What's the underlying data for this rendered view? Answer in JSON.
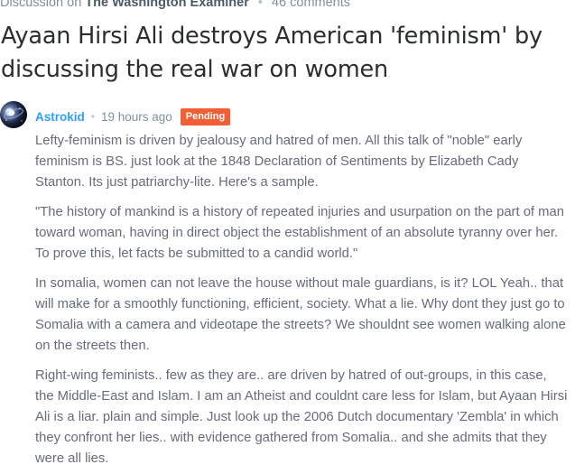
{
  "discussion": {
    "prefix": "Discussion on",
    "site": "The Washington Examiner",
    "separator": "•",
    "comment_count": "46 comments"
  },
  "thread": {
    "title": "Ayaan Hirsi Ali destroys American 'feminism' by discussing the real war on women"
  },
  "comment": {
    "author": "Astrokid",
    "separator": "•",
    "timestamp": "19 hours ago",
    "status_badge": "Pending",
    "status_color": "#f05f36",
    "avatar_icon": "galaxy-avatar",
    "paragraphs": [
      "Lefty-feminism is driven by jealousy and hatred of men. All this talk of \"noble\" early feminism is BS. just look at the 1848 Declaration of Sentiments by Elizabeth Cady Stanton. Its just patriarchy-lite. Here's a sample.",
      "\"The history of mankind is a history of repeated injuries and usurpation on the part of man toward woman, having in direct object the establishment of an absolute tyranny over her. To prove this, let facts be submitted to a candid world.\"",
      "In somalia, women can not leave the house without male guardians, is it? LOL Yeah.. that will make for a smoothly functioning, efficient, society. What a lie. Why dont they just go to Somalia with a camera and videotape the streets? We shouldnt see women walking alone on the streets then.",
      "Right-wing feminists.. few as they are.. are driven by hatred of out-groups, in this case, the Middle-East and Islam. I am an Atheist and couldnt care less for Islam, but Ayaan Hirsi Ali is a liar. plain and simple. Just look up the 2006 Dutch documentary 'Zembla' in which they confront her lies.. with evidence gathered from Somalia.. and she admits that they were all lies."
    ]
  },
  "colors": {
    "author_link": "#2e9fff",
    "body_text": "#656c7a",
    "meta_text": "#7f919e",
    "title_text": "#2a2e2e"
  }
}
